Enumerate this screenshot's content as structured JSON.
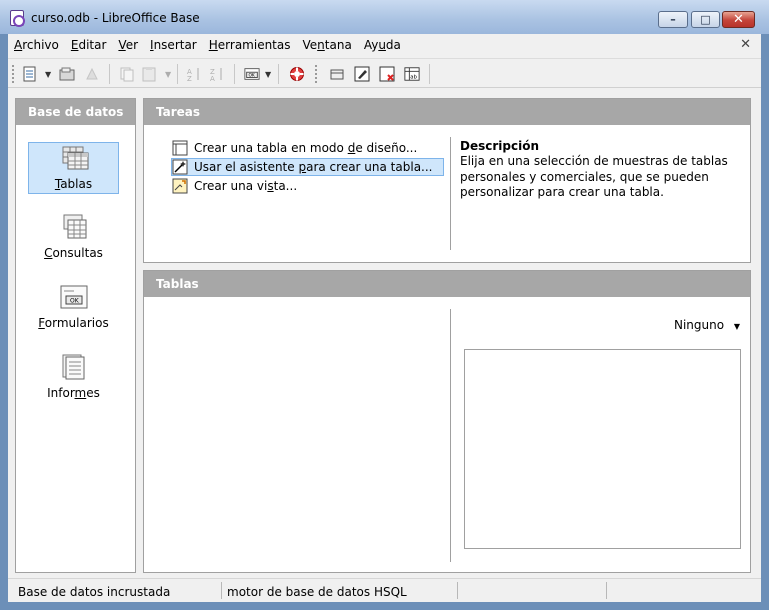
{
  "window": {
    "title": "curso.odb - LibreOffice Base",
    "buttons": {
      "minimize": "–",
      "maximize": "□",
      "close": "✕"
    }
  },
  "menubar": {
    "items": [
      {
        "label": "Archivo",
        "key": "A"
      },
      {
        "label": "Editar",
        "key": "E"
      },
      {
        "label": "Ver",
        "key": "V"
      },
      {
        "label": "Insertar",
        "key": "I"
      },
      {
        "label": "Herramientas",
        "key": "H"
      },
      {
        "label": "Ventana",
        "key": "n"
      },
      {
        "label": "Ayuda",
        "key": "u"
      }
    ],
    "close_doc": "✕"
  },
  "toolbar": {
    "icons": [
      "new-document-icon",
      "open-icon",
      "save-icon",
      "copy-icon",
      "paste-icon",
      "sort-ascending-icon",
      "sort-descending-icon",
      "form-icon",
      "help-lifebuoy-icon",
      "open-database-object-icon",
      "edit-icon",
      "delete-icon",
      "rename-icon"
    ]
  },
  "nav": {
    "header": "Base de datos",
    "items": [
      {
        "label": "Tablas",
        "icon": "tables-icon",
        "selected": true
      },
      {
        "label": "Consultas",
        "icon": "queries-icon",
        "selected": false
      },
      {
        "label": "Formularios",
        "icon": "forms-icon",
        "selected": false
      },
      {
        "label": "Informes",
        "icon": "reports-icon",
        "selected": false
      }
    ]
  },
  "tasks": {
    "header": "Tareas",
    "items": [
      {
        "label": "Crear una tabla en modo de diseño...",
        "icon": "table-design-icon",
        "selected": false
      },
      {
        "label": "Usar el asistente para crear una tabla...",
        "icon": "wizard-icon",
        "selected": true
      },
      {
        "label": "Crear una vista...",
        "icon": "view-icon",
        "selected": false
      }
    ],
    "description_title": "Descripción",
    "description_text": "Elija en una selección de muestras de tablas personales y comerciales, que se pueden personalizar para crear una tabla."
  },
  "tables": {
    "header": "Tablas",
    "preview_mode": "Ninguno"
  },
  "status": {
    "cells": [
      "Base de datos incrustada",
      "motor de base de datos HSQL"
    ]
  },
  "colors": {
    "panel_header": "#a7a7a7",
    "selection": "#cfe6fb",
    "title_bar": "#a9c2e2"
  }
}
